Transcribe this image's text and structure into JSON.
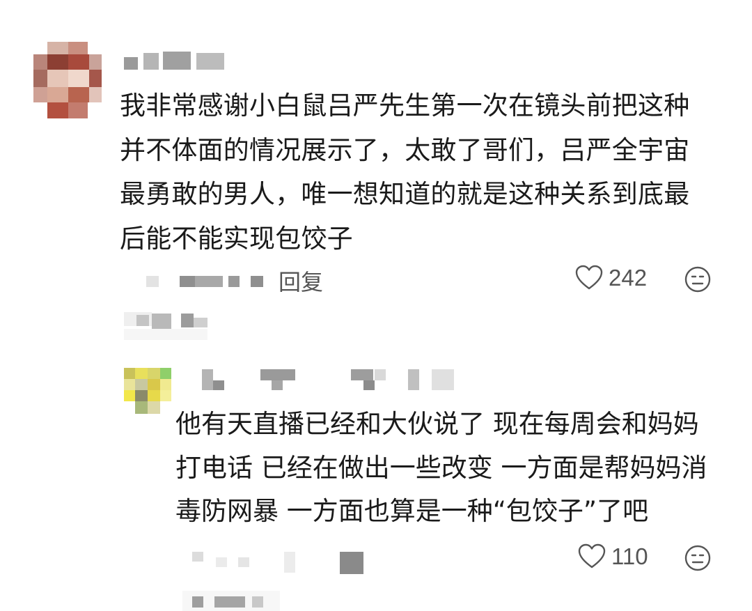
{
  "comment": {
    "text": "我非常感谢小白鼠吕严先生第一次在镜头前把这种\n并不体面的情况展示了，太敢了哥们，吕严全宇宙\n最勇敢的男人，唯一想知道的就是这种关系到底最\n后能不能实现包饺子",
    "reply_label": "回复",
    "likes": "242"
  },
  "reply": {
    "text": "他有天直播已经和大伙说了 现在每周会和妈妈\n打电话 已经在做出一些改变 一方面是帮妈妈消\n毒防网暴 一方面也算是一种“包饺子”了吧",
    "likes": "110"
  },
  "icons": {
    "like": "heart-outline-icon",
    "emoji": "neutral-face-icon"
  },
  "colors": {
    "text": "#1a1a1a",
    "meta": "#555555",
    "blur_dark": "#8c8c8c",
    "blur_light": "#dcdcdc"
  }
}
